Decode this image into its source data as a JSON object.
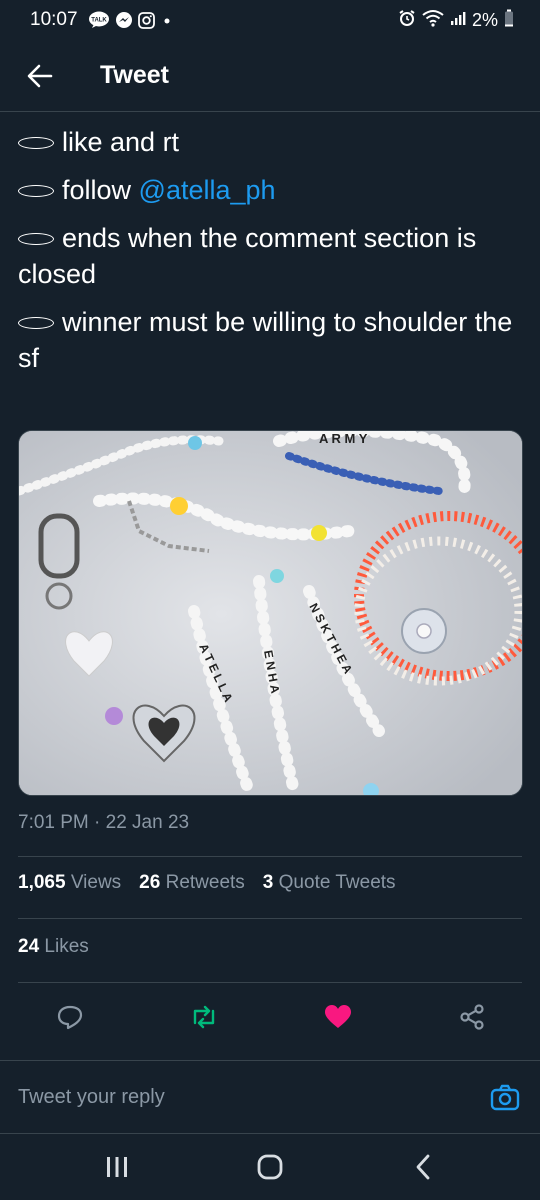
{
  "status_bar": {
    "time": "10:07",
    "battery": "2%",
    "icons": [
      "talk-icon",
      "messenger-icon",
      "instagram-icon",
      "dot-icon",
      "alarm-icon",
      "wifi-icon",
      "signal-icon",
      "battery-icon"
    ]
  },
  "header": {
    "title": "Tweet",
    "back_icon": "arrow-left-icon"
  },
  "tweet": {
    "lines": [
      {
        "text": "like and rt"
      },
      {
        "prefix": "follow ",
        "mention": "@atella_ph"
      },
      {
        "text": "ends when the comment section is closed"
      },
      {
        "text": "winner must be willing to shoulder the sf"
      }
    ],
    "timestamp": "7:01 PM · 22 Jan 23",
    "media_alt": "Beaded phone charms"
  },
  "stats": {
    "views_count": "1,065",
    "views_label": "Views",
    "retweets_count": "26",
    "retweets_label": "Retweets",
    "quotes_count": "3",
    "quotes_label": "Quote Tweets",
    "likes_count": "24",
    "likes_label": "Likes"
  },
  "actions": [
    "reply-icon",
    "retweet-icon",
    "like-icon",
    "share-icon"
  ],
  "colors": {
    "background": "#15202b",
    "accent": "#1d9bf0",
    "retweet_green": "#00ba7c",
    "like_pink": "#f91880",
    "muted": "#8b98a5",
    "divider": "#38444d"
  },
  "reply": {
    "placeholder": "Tweet your reply"
  },
  "nav": [
    "recents-icon",
    "home-icon",
    "back-icon"
  ]
}
